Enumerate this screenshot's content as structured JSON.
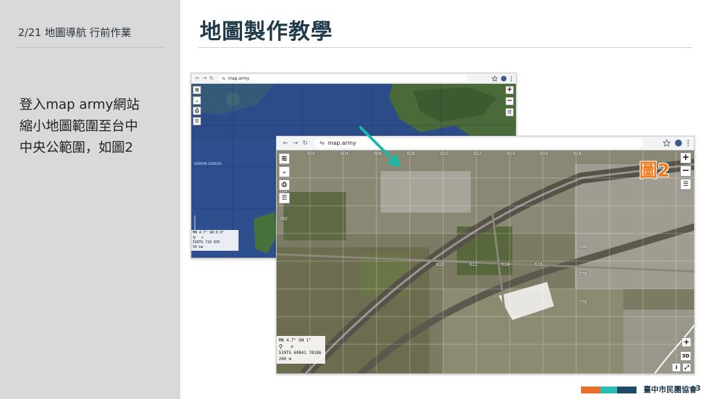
{
  "sidebar": {
    "header": "2/21 地圖導航 行前作業",
    "body_lines": [
      "登入map army網站",
      "縮小地圖範圍至台中",
      "中央公範圍，如圖2"
    ]
  },
  "page_title": "地圖製作教學",
  "browser_small": {
    "url": "map.army",
    "nav": {
      "back": "←",
      "forward": "→",
      "reload": "↻",
      "site_info": "⇆"
    },
    "map_labels": [
      "SORON",
      "GORON"
    ],
    "status": {
      "mn": "MN 4.7° GN 0.9°",
      "grid": "51RTG 718 835",
      "scale": "50 km"
    }
  },
  "browser_large": {
    "url": "map.army",
    "nav": {
      "back": "←",
      "forward": "→",
      "reload": "↻",
      "site_info": "⇆"
    },
    "grid_ticks_top": [
      "602",
      "604",
      "606",
      "608",
      "610",
      "612",
      "614",
      "616",
      "618"
    ],
    "grid_ticks_inner": [
      "610",
      "612",
      "614",
      "616",
      "780",
      "778",
      "776",
      "782",
      "784",
      "786"
    ],
    "status": {
      "mn": "MN 4.7° GN 1°",
      "grid": "51RTG 60841 78186",
      "scale": "200 m"
    },
    "three_d": "3D"
  },
  "figure_label": "圖2",
  "footer": {
    "organization": "臺中市民團協會",
    "page_number": "3",
    "colors": [
      "#e8702a",
      "#2bbfb3",
      "#1f4a68",
      "#1f3a4a"
    ]
  },
  "icons": {
    "zoom_in": "+",
    "zoom_out": "−",
    "layers": "layers-icon",
    "print": "print-icon",
    "menu": "menu-icon",
    "pin": "pin-icon",
    "search": "search-icon",
    "star": "star-icon",
    "more": "more-icon"
  },
  "colors": {
    "sidebar_bg": "#d9d9d9",
    "title": "#1f3a4a",
    "arrow": "#1fb8a6",
    "figure_label": "#f07a1f"
  }
}
